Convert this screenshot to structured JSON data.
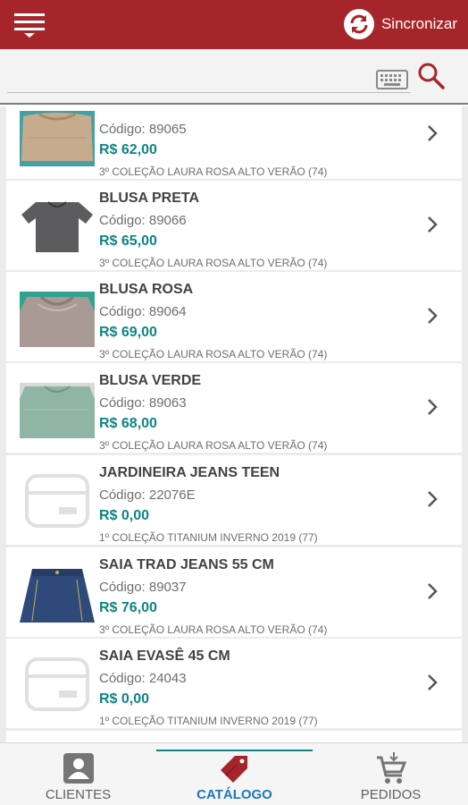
{
  "header": {
    "sync_label": "Sincronizar",
    "menu_icon": "hamburger-menu-icon",
    "sync_icon": "sync-icon",
    "brand_color": "#a6252a"
  },
  "search": {
    "keyboard_icon": "keyboard-icon",
    "search_icon": "search-icon"
  },
  "products": [
    {
      "name": "",
      "code": "Código: 89065",
      "price": "R$ 62,00",
      "collection": "3º COLEÇÃO LAURA ROSA ALTO VERÃO (74)",
      "image": "tan-blouse-photo"
    },
    {
      "name": "BLUSA PRETA",
      "code": "Código: 89066",
      "price": "R$ 65,00",
      "collection": "3º COLEÇÃO LAURA ROSA ALTO VERÃO (74)",
      "image": "dark-gray-blouse-photo"
    },
    {
      "name": "BLUSA ROSA",
      "code": "Código: 89064",
      "price": "R$ 69,00",
      "collection": "3º COLEÇÃO LAURA ROSA ALTO VERÃO (74)",
      "image": "pink-blouse-photo"
    },
    {
      "name": "BLUSA VERDE",
      "code": "Código: 89063",
      "price": "R$ 68,00",
      "collection": "3º COLEÇÃO LAURA ROSA ALTO VERÃO (74)",
      "image": "green-blouse-photo"
    },
    {
      "name": "JARDINEIRA JEANS TEEN",
      "code": "Código: 22076E",
      "price": "R$ 0,00",
      "collection": "1º COLEÇÃO TITANIUM INVERNO 2019 (77)",
      "image": "placeholder-image-icon"
    },
    {
      "name": "SAIA  TRAD JEANS 55 CM",
      "code": "Código: 89037",
      "price": "R$ 76,00",
      "collection": "3º COLEÇÃO LAURA ROSA ALTO VERÃO (74)",
      "image": "jeans-skirt-photo"
    },
    {
      "name": "SAIA EVASÊ 45 CM",
      "code": "Código: 24043",
      "price": "R$ 0,00",
      "collection": "1º COLEÇÃO TITANIUM INVERNO 2019 (77)",
      "image": "placeholder-image-icon"
    }
  ],
  "tabs": [
    {
      "label": "CLIENTES",
      "icon": "person-badge-icon",
      "active": false
    },
    {
      "label": "CATÁLOGO",
      "icon": "price-tag-icon",
      "active": true
    },
    {
      "label": "PEDIDOS",
      "icon": "shopping-cart-icon",
      "active": false
    }
  ],
  "colors": {
    "price": "#0f8484",
    "active_tab": "#1e77b6",
    "tag": "#a6252a"
  }
}
